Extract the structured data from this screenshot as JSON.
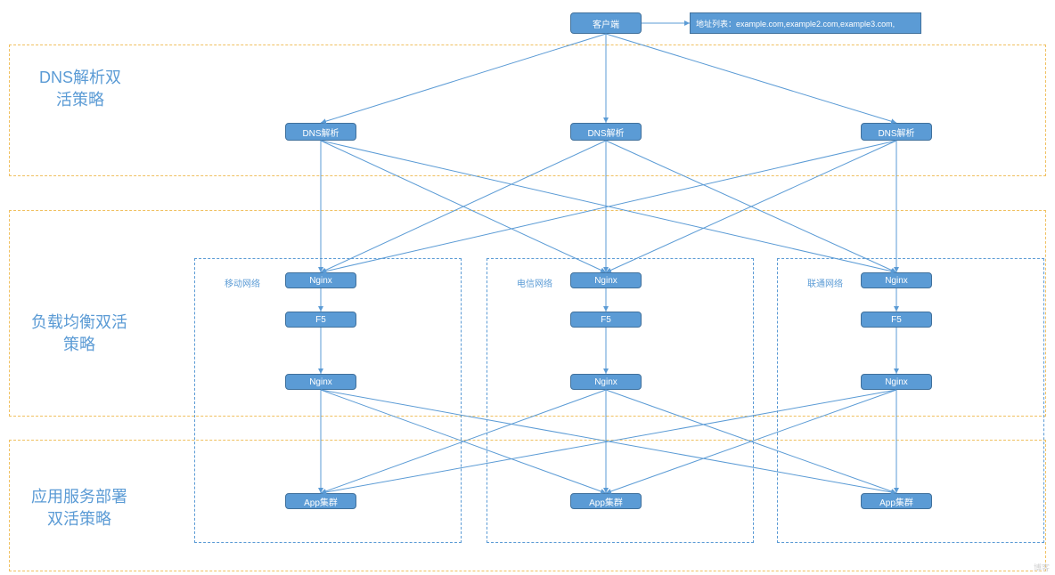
{
  "sections": {
    "dns": "DNS解析双\n活策略",
    "lb": "负载均衡双活\n策略",
    "app": "应用服务部署\n双活策略"
  },
  "nodes": {
    "client": "客户端",
    "addrlist": "地址列表：example.com,example2.com,example3.com,",
    "dns1": "DNS解析",
    "dns2": "DNS解析",
    "dns3": "DNS解析",
    "net1": "移动网络",
    "net2": "电信网络",
    "net3": "联通网络",
    "nginxTop": "Nginx",
    "f5": "F5",
    "nginxBot": "Nginx",
    "app1": "App集群",
    "app2": "App集群",
    "app3": "App集群"
  },
  "watermark": "博客"
}
